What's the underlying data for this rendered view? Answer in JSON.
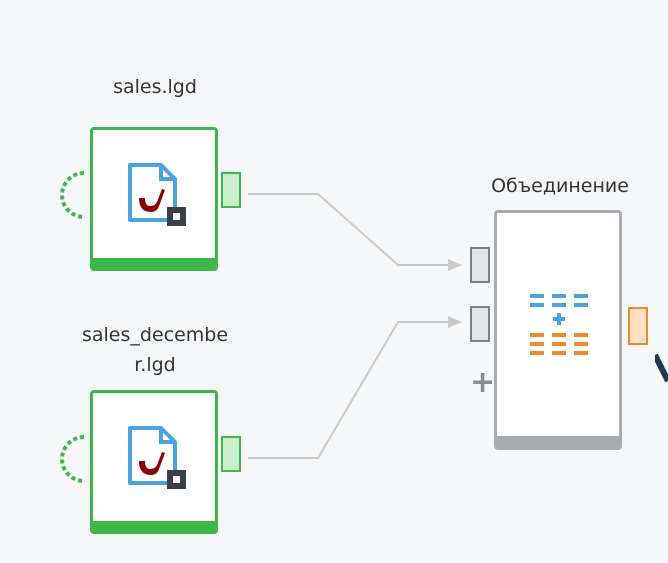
{
  "nodes": {
    "sales": {
      "title": "sales.lgd"
    },
    "sales_december": {
      "title": "sales_decembe\nr.lgd"
    },
    "merge": {
      "title": "Объединение"
    }
  },
  "ports": {
    "add_port_symbol": "+"
  },
  "colors": {
    "reader_border": "#3fb64a",
    "merge_border": "#a8abb0",
    "output_orange": "#ec8b2a",
    "icon_red": "#8b0000",
    "icon_blue": "#4aa3df"
  },
  "icons": {
    "reader_icon": "pipe-file-icon",
    "merge_icon": "union-lines-icon"
  }
}
